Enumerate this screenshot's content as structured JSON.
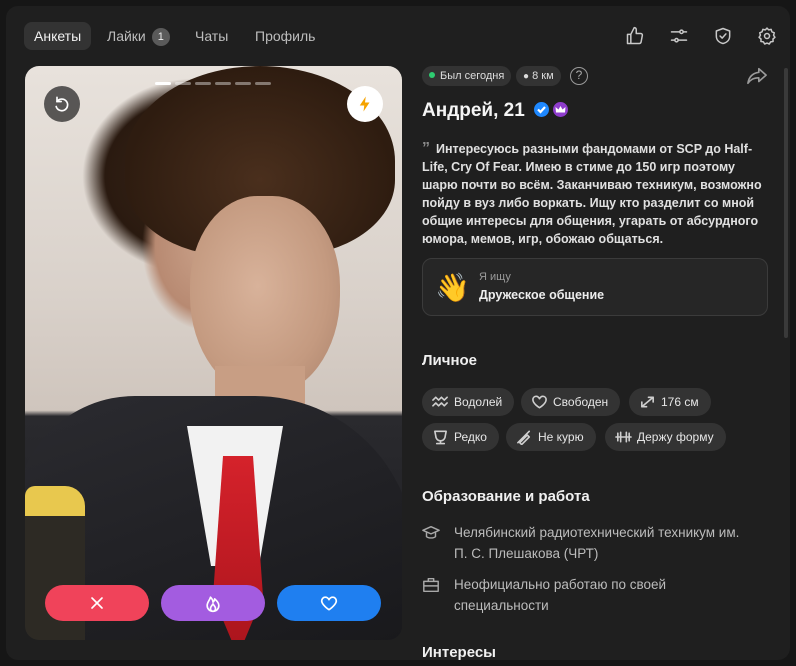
{
  "nav": {
    "tabs": [
      {
        "label": "Анкеты"
      },
      {
        "label": "Лайки",
        "badge": "1"
      },
      {
        "label": "Чаты"
      },
      {
        "label": "Профиль"
      }
    ],
    "icons": [
      "thumbs-up-icon",
      "sliders-icon",
      "shield-check-icon",
      "gear-icon"
    ]
  },
  "photo": {
    "page_count": 6,
    "current_page": 1,
    "actions": [
      "close-icon",
      "fire-icon",
      "heart-icon"
    ],
    "colors": {
      "dislike": "#f0435a",
      "superlike": "#a35ce0",
      "like": "#1f7ff0",
      "boost": "#f5a300"
    }
  },
  "profile": {
    "last_seen": "Был сегодня",
    "distance": "8 км",
    "help": "?",
    "name": "Андрей, 21",
    "bio_quote": "”",
    "bio": "Интересуюсь разными фандомами от SCP до Half-Life, Cry Of Fear. Имею в стиме до 150 игр поэтому шарю почти во всём. Заканчиваю техникум, возможно пойду в вуз либо воркать. Ищу кто разделит со мной общие интересы для общения, угарать от абсурдного юмора, мемов, игр, обожаю общаться.",
    "seeking": {
      "emoji": "👋",
      "label": "Я ищу",
      "value": "Дружеское общение"
    }
  },
  "personal": {
    "title": "Личное",
    "chips": [
      {
        "label": "Водолей",
        "icon": "aquarius-icon"
      },
      {
        "label": "Свободен",
        "icon": "heart-icon"
      },
      {
        "label": "176 см",
        "icon": "height-icon"
      },
      {
        "label": "Редко",
        "icon": "glass-icon"
      },
      {
        "label": "Не курю",
        "icon": "no-smoking-icon"
      },
      {
        "label": "Держу форму",
        "icon": "dumbbell-icon"
      }
    ]
  },
  "education": {
    "title": "Образование и работа",
    "school": "Челябинский радиотехнический техникум им. П. С. Плешакова (ЧРТ)",
    "work": "Неофициально работаю по своей специальности"
  },
  "interests": {
    "title": "Интересы"
  }
}
